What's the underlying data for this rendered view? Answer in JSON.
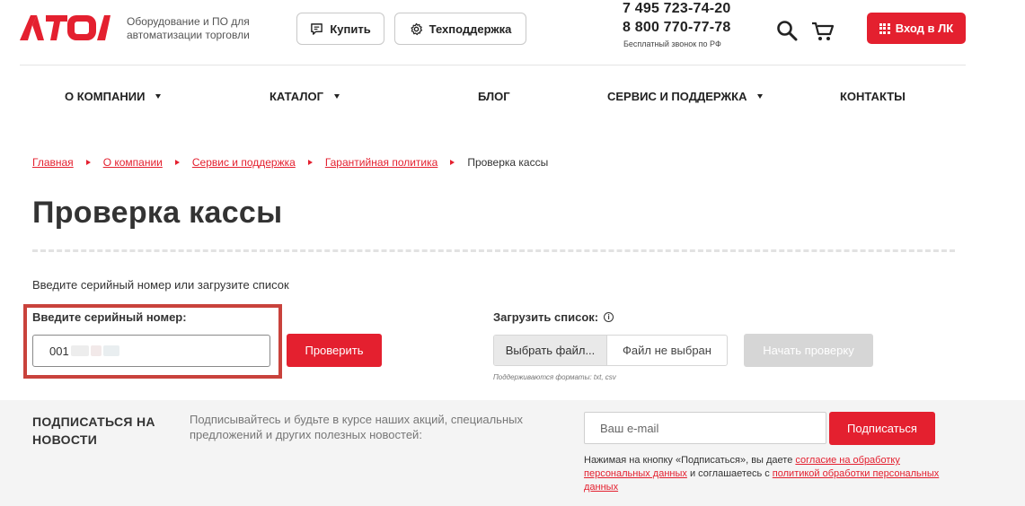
{
  "header": {
    "logo_text": "ATOL",
    "tagline": "Оборудование и ПО для автоматизации торговли",
    "buy_label": "Купить",
    "support_label": "Техподдержка",
    "phone_1": "7 495 723-74-20",
    "phone_2": "8 800 770-77-78",
    "phone_note": "Бесплатный звонок по РФ",
    "login_label": "Вход в ЛК",
    "brand_color": "#e4202f"
  },
  "nav": {
    "items": [
      {
        "label": "О КОМПАНИИ",
        "has_dropdown": true
      },
      {
        "label": "КАТАЛОГ",
        "has_dropdown": true
      },
      {
        "label": "БЛОГ",
        "has_dropdown": false
      },
      {
        "label": "СЕРВИС И ПОДДЕРЖКА",
        "has_dropdown": true
      },
      {
        "label": "КОНТАКТЫ",
        "has_dropdown": false
      }
    ]
  },
  "breadcrumb": {
    "links": [
      "Главная",
      "О компании",
      "Сервис и поддержка",
      "Гарантийная политика"
    ],
    "current": "Проверка кассы"
  },
  "page": {
    "title": "Проверка кассы",
    "intro": "Введите серийный номер или загрузите список"
  },
  "serial": {
    "label": "Введите серийный номер:",
    "value": "001",
    "check_label": "Проверить"
  },
  "upload": {
    "label": "Загрузить список:",
    "info_glyph": "i",
    "choose_label": "Выбрать файл...",
    "status": "Файл не выбран",
    "start_label": "Начать проверку",
    "formats_note": "Поддерживаются форматы: txt, csv"
  },
  "subscribe": {
    "title": "ПОДПИСАТЬСЯ НА НОВОСТИ",
    "text": "Подписывайтесь и будьте в курсе наших акций, специальных предложений и других полезных новостей:",
    "email_placeholder": "Ваш e-mail",
    "button_label": "Подписаться",
    "consent_prefix": "Нажимая на кнопку «Подписаться», вы даете",
    "consent_link_1": "согласие на обработку персональных данных",
    "consent_middle": "и соглашаетесь с",
    "consent_link_2": "политикой обработки персональных данных"
  }
}
